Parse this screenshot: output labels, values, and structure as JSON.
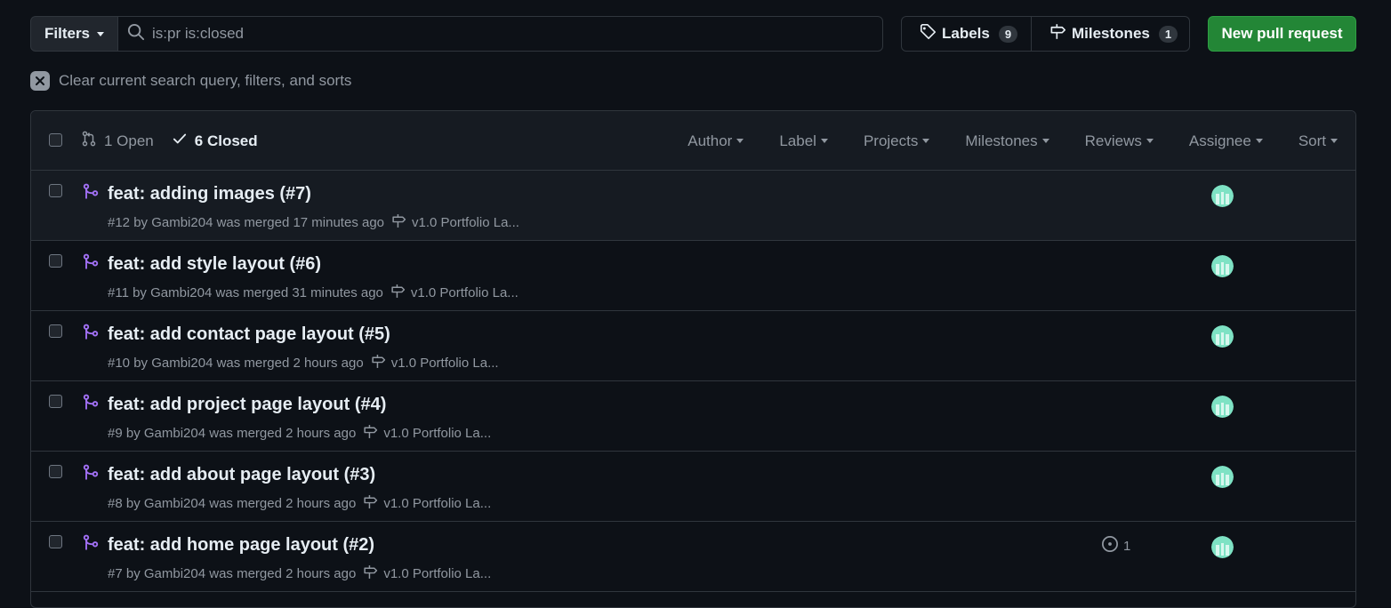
{
  "toolbar": {
    "filters_label": "Filters",
    "search_value": "is:pr is:closed",
    "labels_label": "Labels",
    "labels_count": "9",
    "milestones_label": "Milestones",
    "milestones_count": "1",
    "new_pr_label": "New pull request"
  },
  "clear_text": "Clear current search query, filters, and sorts",
  "header": {
    "open_label": "1 Open",
    "closed_label": "6 Closed",
    "filters": [
      "Author",
      "Label",
      "Projects",
      "Milestones",
      "Reviews",
      "Assignee",
      "Sort"
    ]
  },
  "prs": [
    {
      "title": "feat: adding images (#7)",
      "meta": "#12 by Gambi204 was merged 17 minutes ago",
      "milestone": "v1.0 Portfolio La...",
      "comments": ""
    },
    {
      "title": "feat: add style layout (#6)",
      "meta": "#11 by Gambi204 was merged 31 minutes ago",
      "milestone": "v1.0 Portfolio La...",
      "comments": ""
    },
    {
      "title": "feat: add contact page layout (#5)",
      "meta": "#10 by Gambi204 was merged 2 hours ago",
      "milestone": "v1.0 Portfolio La...",
      "comments": ""
    },
    {
      "title": "feat: add project page layout (#4)",
      "meta": "#9 by Gambi204 was merged 2 hours ago",
      "milestone": "v1.0 Portfolio La...",
      "comments": ""
    },
    {
      "title": "feat: add about page layout (#3)",
      "meta": "#8 by Gambi204 was merged 2 hours ago",
      "milestone": "v1.0 Portfolio La...",
      "comments": ""
    },
    {
      "title": "feat: add home page layout (#2)",
      "meta": "#7 by Gambi204 was merged 2 hours ago",
      "milestone": "v1.0 Portfolio La...",
      "comments": "1"
    }
  ],
  "colors": {
    "background": "#0d1117",
    "header_bg": "#161b22",
    "border": "#30363d",
    "merged_purple": "#a371f7",
    "primary_green": "#238636",
    "muted_text": "#9198a1"
  }
}
